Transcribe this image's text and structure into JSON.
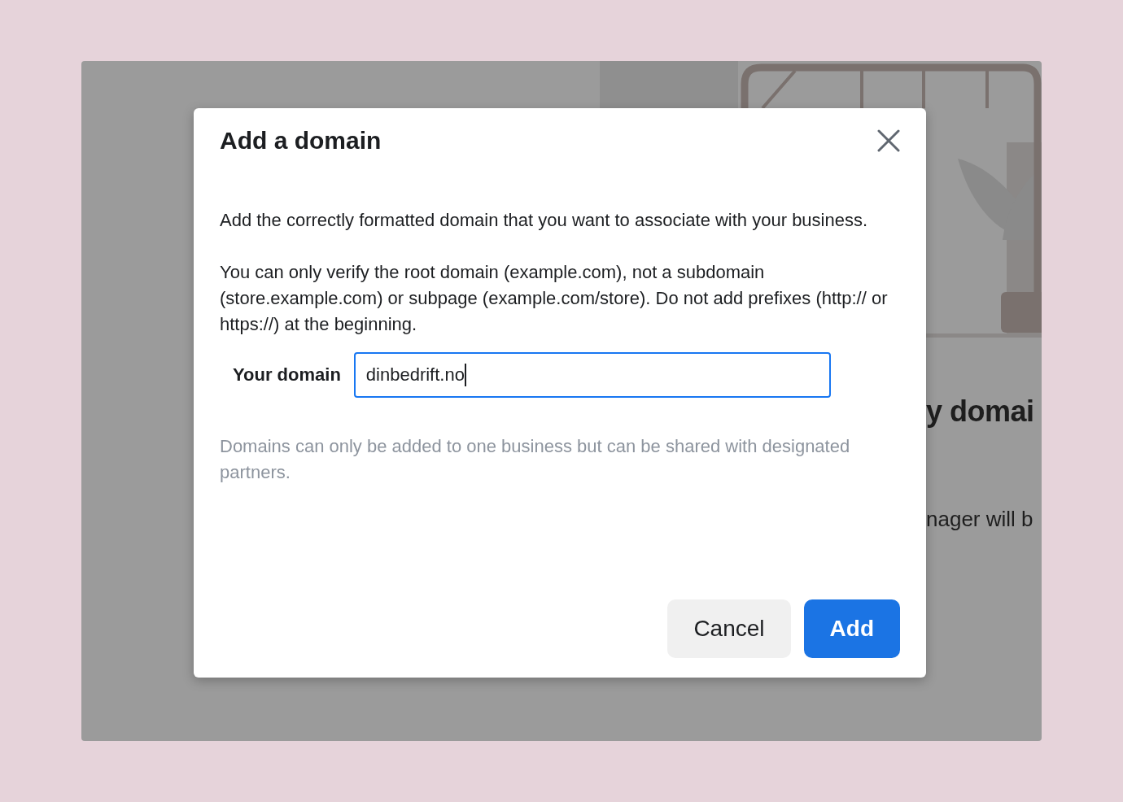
{
  "background": {
    "heading": "y domai",
    "text": "nager will b"
  },
  "dialog": {
    "title": "Add a domain",
    "paragraphs": [
      "Add the correctly formatted domain that you want to associate with your business.",
      "You can only verify the root domain (example.com), not a subdomain (store.example.com) or subpage (example.com/store). Do not add prefixes (http:// or https://) at the beginning."
    ],
    "field": {
      "label": "Your domain",
      "value": "dinbedrift.no",
      "focused": true
    },
    "hint": "Domains can only be added to one business but can be shared with designated partners.",
    "buttons": [
      {
        "label": "Cancel",
        "kind": "secondary"
      },
      {
        "label": "Add",
        "kind": "primary"
      }
    ]
  }
}
